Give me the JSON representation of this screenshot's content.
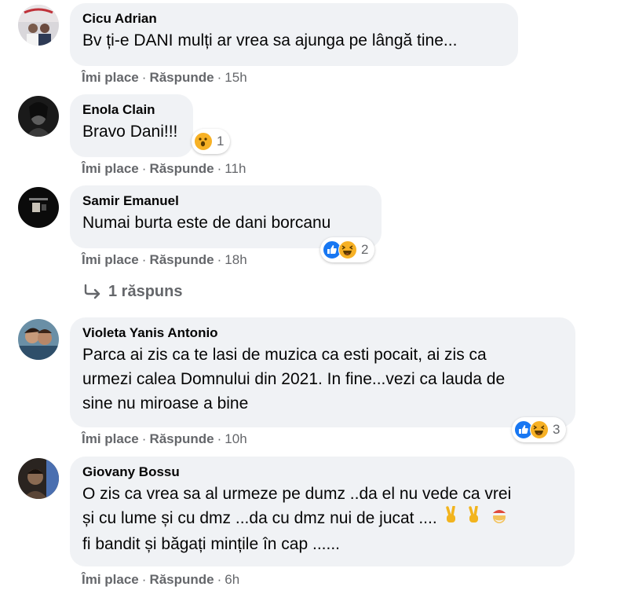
{
  "actions": {
    "like": "Îmi place",
    "reply": "Răspunde",
    "sep": "·"
  },
  "colors": {
    "bubble": "#f0f2f5",
    "meta": "#65676b",
    "like_blue": "#1877f2",
    "reaction_yellow": "#f7b125"
  },
  "comments": [
    {
      "author": "Cicu Adrian",
      "lines": [
        "Bv ți-e DANI mulți ar vrea sa ajunga pe lângă tine..."
      ],
      "time": "15h"
    },
    {
      "author": "Enola Clain",
      "lines": [
        "Bravo Dani!!!"
      ],
      "time": "11h",
      "reactions": {
        "icons": [
          "wow-emoji-icon"
        ],
        "count": "1"
      }
    },
    {
      "author": "Samir Emanuel",
      "lines": [
        "Numai burta este de dani borcanu"
      ],
      "time": "18h",
      "reactions": {
        "icons": [
          "like-icon",
          "haha-emoji-icon"
        ],
        "count": "2"
      }
    },
    {
      "author": "Violeta Yanis Antonio",
      "lines": [
        "Parca ai zis ca te lasi de muzica ca esti pocait, ai zis ca",
        "urmezi calea Domnului din 2021. In fine...vezi ca lauda de",
        "sine nu miroase a bine"
      ],
      "time": "10h",
      "reactions": {
        "icons": [
          "like-icon",
          "haha-emoji-icon"
        ],
        "count": "3"
      }
    },
    {
      "author": "Giovany Bossu",
      "lines": [
        "O zis ca vrea sa al urmeze pe dumz ..da el nu vede ca vrei",
        "și cu lume și cu dmz ...da cu dmz nui de jucat ....",
        "fi bandit și băgați mințile în cap ......"
      ],
      "time": "6h",
      "inline_emojis": [
        "victory-hand-icon",
        "victory-hand-icon",
        "santa-emoji-icon"
      ]
    }
  ],
  "replies": {
    "label": "1 răspuns",
    "icon": "reply-arrow-icon"
  }
}
